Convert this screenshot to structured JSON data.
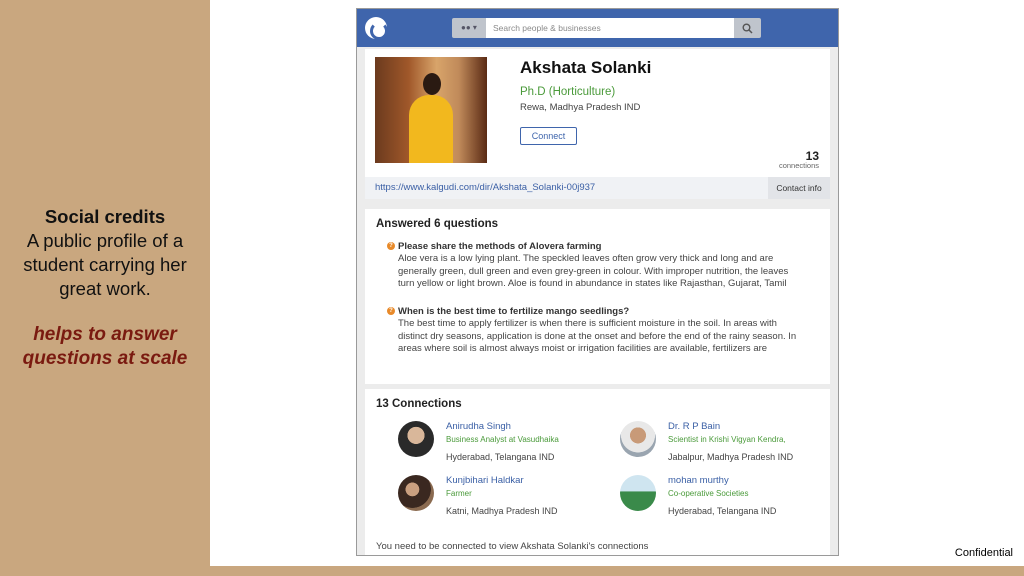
{
  "slide": {
    "title": "Social credits",
    "body": "A public profile of a student carrying her great work.",
    "emphasis": "helps to answer questions at scale",
    "footer": "Confidential"
  },
  "screenshot": {
    "topbar": {
      "search_placeholder": "Search people & businesses",
      "icons": [
        "app-logo-icon",
        "people-scope-icon",
        "search-icon"
      ]
    },
    "profile": {
      "name": "Akshata Solanki",
      "degree": "Ph.D (Horticulture)",
      "location": "Rewa, Madhya Pradesh IND",
      "connect_label": "Connect",
      "connections_count": "13",
      "connections_label": "connections",
      "url": "https://www.kalgudi.com/dir/Akshata_Solanki-00j937",
      "contact_info_label": "Contact info"
    },
    "answers": {
      "title": "Answered 6 questions",
      "items": [
        {
          "question": "Please share the methods of Alovera farming",
          "answer_lines": [
            "Aloe vera is a low lying plant. The speckled leaves often grow very thick and long and are",
            "generally green, dull green and even grey-green in colour. With improper nutrition, the leaves",
            "turn yellow or light brown. Aloe is found in abundance in states like Rajasthan, Gujarat, Tamil"
          ]
        },
        {
          "question": "When is the best time to fertilize mango seedlings?",
          "answer_lines": [
            "The best time to apply fertilizer is when there is sufficient moisture in the soil. In areas with",
            "distinct dry seasons, application is done at the onset and before the end of the rainy season. In",
            "areas where soil is almost always moist or irrigation facilities are available, fertilizers are"
          ]
        }
      ]
    },
    "connections": {
      "title": "13 Connections",
      "people": [
        {
          "name": "Anirudha Singh",
          "role": "Business Analyst at Vasudhaika",
          "location": "Hyderabad, Telangana IND"
        },
        {
          "name": "Dr. R P Bain",
          "role": "Scientist in Krishi Vigyan Kendra,",
          "location": "Jabalpur, Madhya Pradesh IND"
        },
        {
          "name": "Kunjbihari Haldkar",
          "role": "Farmer",
          "location": "Katni, Madhya Pradesh IND"
        },
        {
          "name": "mohan murthy",
          "role": "Co-operative Societies",
          "location": "Hyderabad, Telangana IND"
        }
      ],
      "note": "You need to be connected to view Akshata Solanki's connections"
    }
  }
}
